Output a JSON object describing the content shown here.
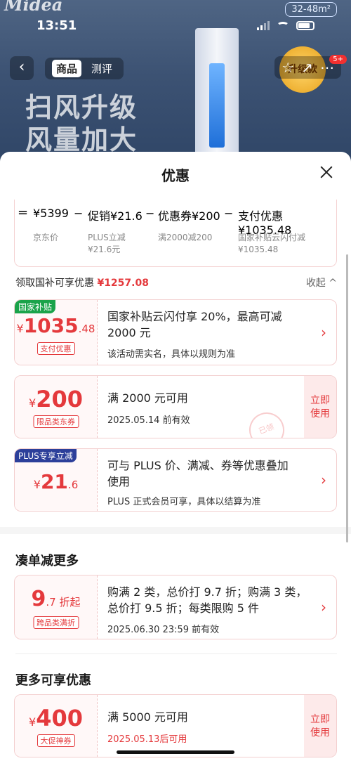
{
  "background": {
    "brand": "Midea",
    "area_badge": "32-48m²",
    "time": "13:51",
    "tabs": [
      "商品",
      "测评"
    ],
    "notification_count": "5+",
    "slogan_line1": "扫风升级",
    "slogan_line2": "风量加大",
    "upgrade_badge": "升级款"
  },
  "sheet": {
    "title": "优惠",
    "calc": {
      "eq": "=",
      "base_price": "¥5399",
      "base_label": "京东价",
      "minus": "−",
      "promo": "促销¥21.6",
      "promo_sub1": "PLUS立减",
      "promo_sub2": "¥21.6元",
      "coupon": "优惠券¥200",
      "coupon_sub": "满2000减200",
      "pay": "支付优惠¥1035.48",
      "pay_sub1": "国家补贴云闪付减",
      "pay_sub2": "¥1035.48"
    },
    "subsidy_row": {
      "label": "领取国补可享优惠",
      "amount": "¥1257.08",
      "fold": "收起 ^"
    },
    "cards": [
      {
        "tag": "国家补贴",
        "currency": "¥",
        "int": "1035",
        "dec": ".48",
        "label": "支付优惠",
        "line1": "国家补贴云闪付享 20%，最高可减",
        "line2": "2000 元",
        "note": "该活动需实名，具体以规则为准"
      },
      {
        "currency": "¥",
        "int": "200",
        "label": "限品类东券",
        "line1": "满 2000 元可用",
        "note": "2025.05.14 前有效",
        "action1": "立即",
        "action2": "使用",
        "stamp": "已领"
      },
      {
        "tag": "PLUS专享立减",
        "currency": "¥",
        "int": "21",
        "dec": ".6",
        "line1": "可与 PLUS 价、满减、券等优惠叠加",
        "line2": "使用",
        "note": "PLUS 正式会员可享，具体以结算为准"
      }
    ],
    "section2_title": "凑单减更多",
    "card4": {
      "int": "9",
      "dec": ".7 折起",
      "label": "跨品类满折",
      "line1": "购满 2 类，总价打 9.7 折；购满 3 类，",
      "line2": "总价打 9.5 折；每类限购 5 件",
      "note": "2025.06.30 23:59 前有效"
    },
    "section3_title": "更多可享优惠",
    "card5": {
      "currency": "¥",
      "int": "400",
      "label": "大促神券",
      "line1": "满 5000 元可用",
      "note": "2025.05.13后可用",
      "action1": "立即",
      "action2": "使用"
    }
  },
  "colors": {
    "accent": "#e4393c",
    "tag_green": "#1aa34a",
    "tag_blue": "#2c3f9a"
  }
}
